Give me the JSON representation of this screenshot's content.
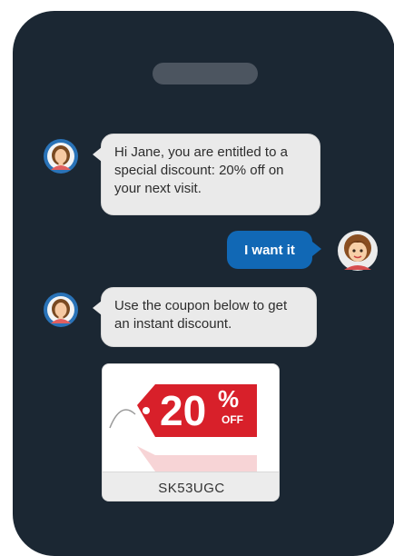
{
  "messages": [
    {
      "from": "agent",
      "text": "Hi Jane, you are entitled to a special discount: 20% off on your next visit."
    },
    {
      "from": "user",
      "text": "I want it"
    },
    {
      "from": "agent",
      "text": "Use the coupon below to get an instant discount."
    }
  ],
  "coupon": {
    "percent": "20",
    "percent_sign": "%",
    "off_label": "OFF",
    "code": "SK53UGC"
  },
  "colors": {
    "phone_frame": "#1b2733",
    "user_bubble": "#1168b5",
    "agent_bubble": "#eaeaea",
    "tag_red": "#d8202a"
  },
  "icons": [
    "agent-avatar-icon",
    "user-avatar-icon",
    "discount-tag-icon"
  ]
}
